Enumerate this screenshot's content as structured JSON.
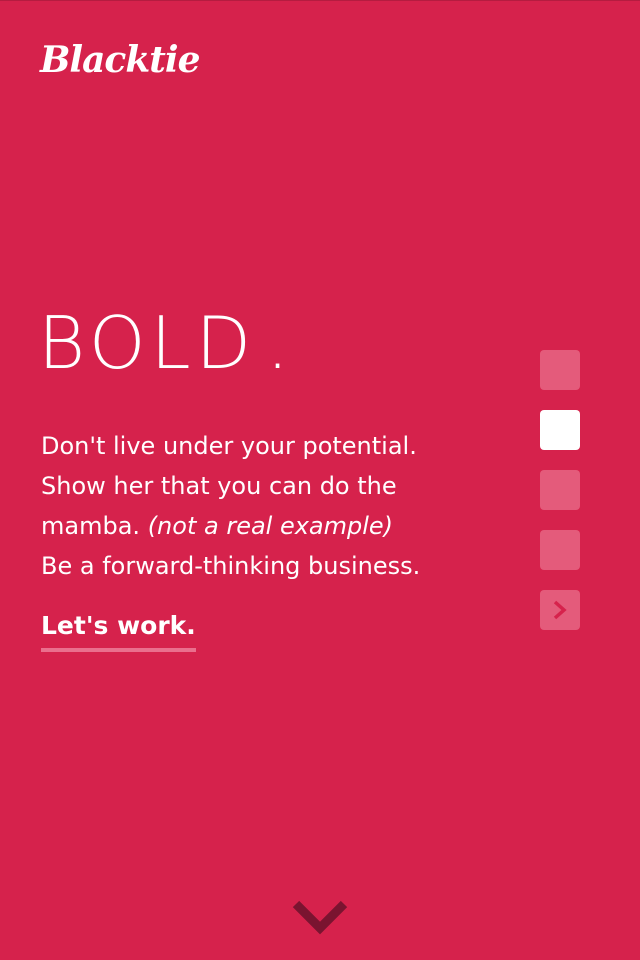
{
  "brand": {
    "logo_text": "Blacktie"
  },
  "hero": {
    "title_main": "BOLD",
    "title_tail": ".",
    "lines": [
      "Don't live under your potential.",
      "Show her that you can do the",
      "mamba.",
      "(not a real example)",
      "Be a forward-thinking business."
    ],
    "cta_label": "Let's work."
  },
  "pager": {
    "slides": 4,
    "active_index": 1,
    "next_icon": "chevron-right-icon"
  },
  "scroll": {
    "icon": "chevron-down-icon"
  },
  "colors": {
    "background": "#d6224c",
    "pager_inactive": "#e45b7b",
    "pager_active": "#ffffff",
    "cta_underline": "#ea6f8d",
    "down_arrow": "#7a1430"
  }
}
